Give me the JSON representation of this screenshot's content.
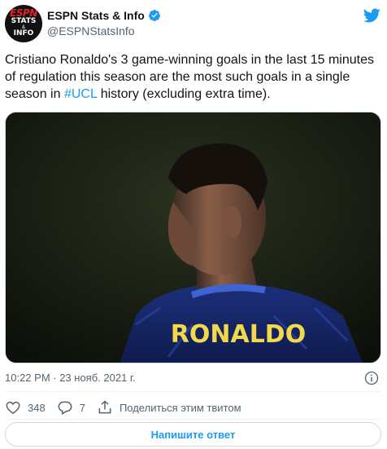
{
  "author": {
    "display_name": "ESPN Stats & Info",
    "handle": "@ESPNStatsInfo",
    "avatar_text": {
      "brand": "ESPN",
      "line1": "STATS",
      "line2": "&",
      "line3": "INFO"
    },
    "verified": true
  },
  "tweet": {
    "text_before": "Cristiano Ronaldo's 3 game-winning goals in the last 15 minutes of regulation this season are the most such goals in a single season in ",
    "hashtag": "#UCL",
    "text_after": " history (excluding extra time)."
  },
  "media": {
    "jersey_text": "RONALDO"
  },
  "meta": {
    "timestamp": "10:22 PM · 23 нояб. 2021 г."
  },
  "actions": {
    "likes": "348",
    "replies": "7",
    "share_label": "Поделиться этим твитом"
  },
  "reply_button": {
    "label": "Напишите ответ"
  },
  "colors": {
    "accent": "#1d9bf0",
    "secondary_text": "#536471",
    "border": "#cfd9de"
  },
  "icons": [
    "twitter-logo-icon",
    "verified-badge-icon",
    "info-icon",
    "heart-icon",
    "reply-icon",
    "share-icon"
  ]
}
